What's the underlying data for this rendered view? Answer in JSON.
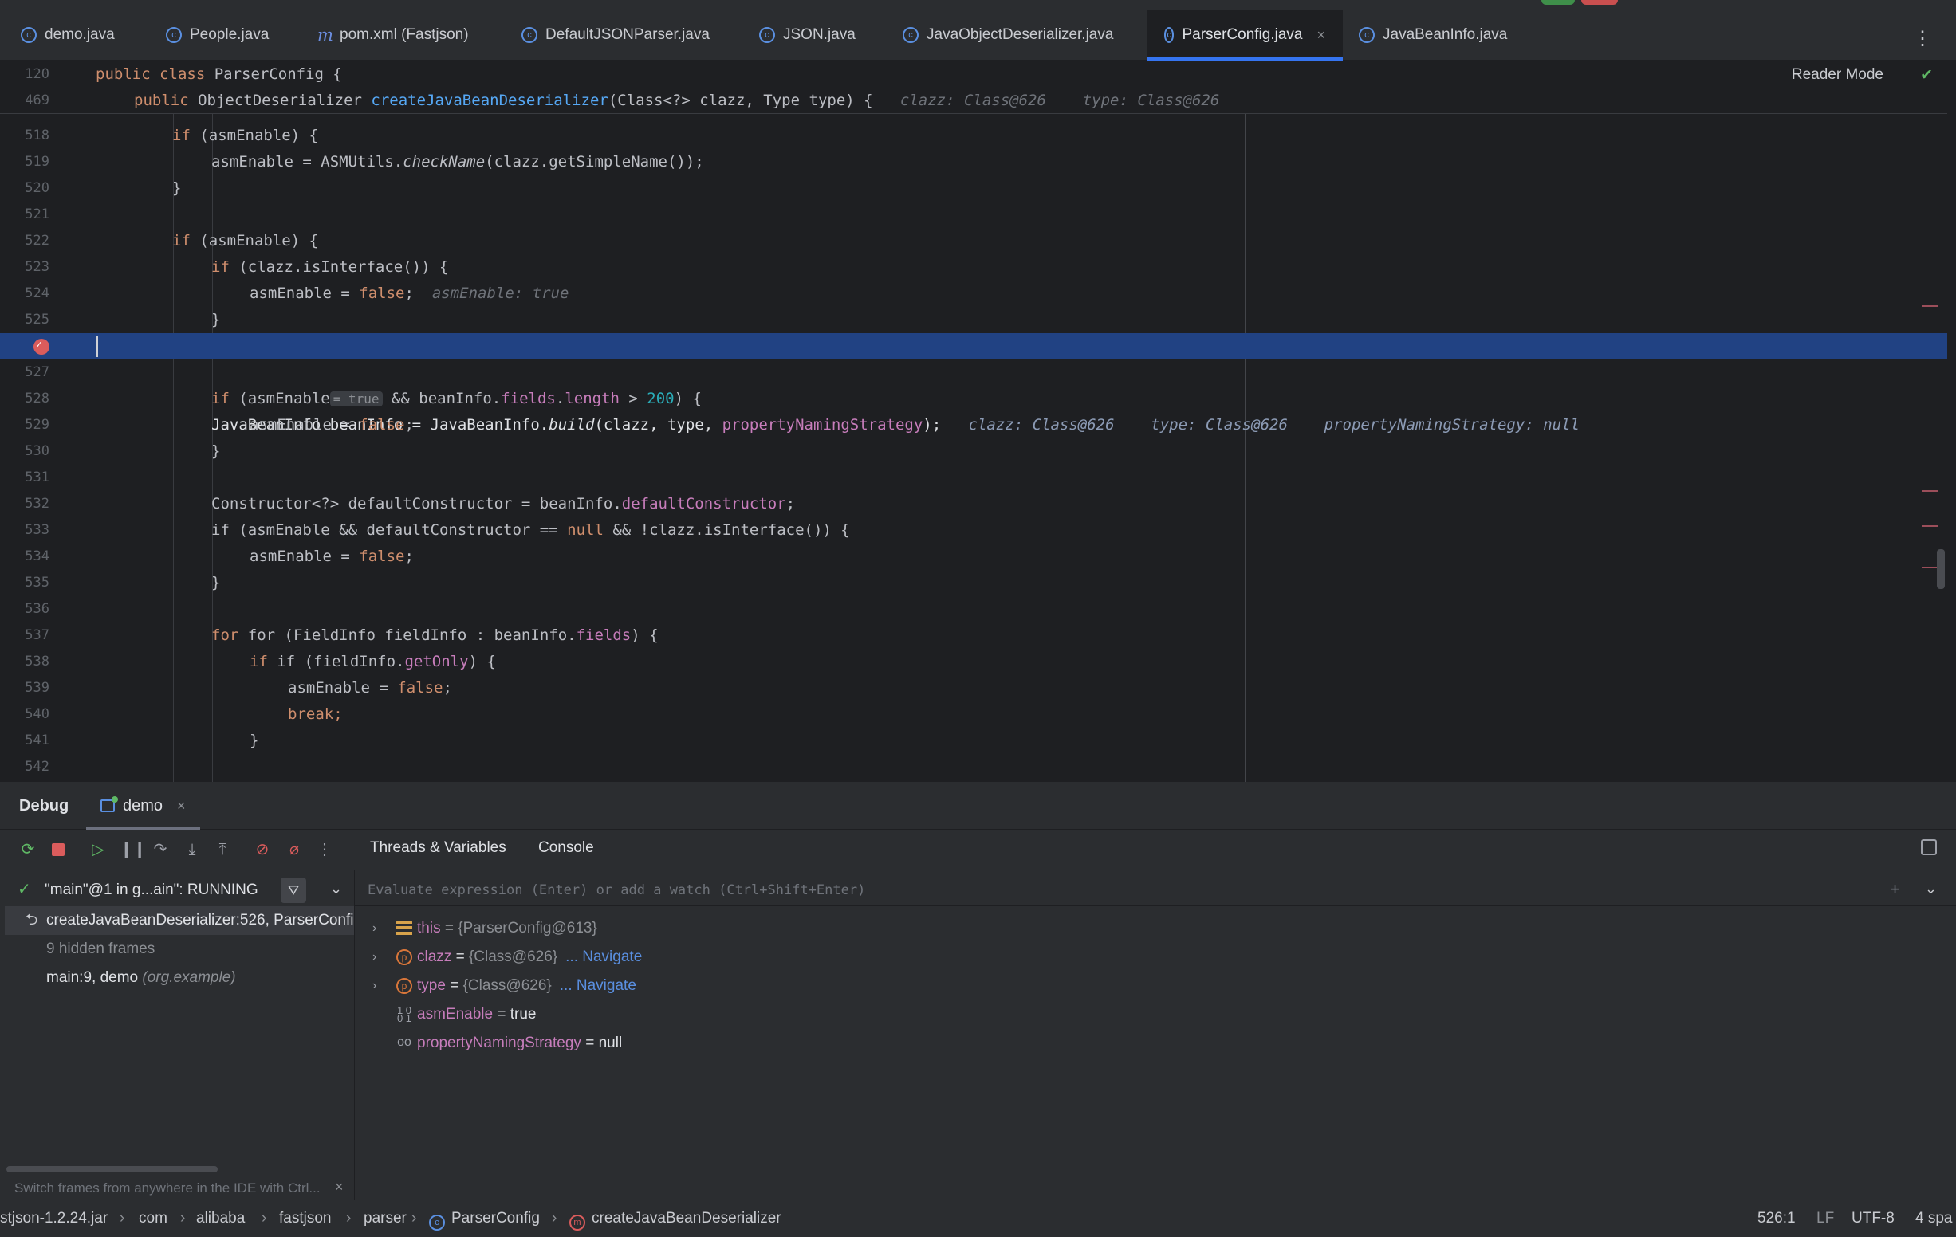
{
  "tabs": [
    {
      "label": "demo.java",
      "icon": "class-icon"
    },
    {
      "label": "People.java",
      "icon": "class-icon"
    },
    {
      "label": "pom.xml (Fastjson)",
      "icon": "maven-icon"
    },
    {
      "label": "DefaultJSONParser.java",
      "icon": "class-icon"
    },
    {
      "label": "JSON.java",
      "icon": "class-icon"
    },
    {
      "label": "JavaObjectDeserializer.java",
      "icon": "class-icon"
    },
    {
      "label": "ParserConfig.java",
      "icon": "class-icon",
      "active": true
    },
    {
      "label": "JavaBeanInfo.java",
      "icon": "class-icon"
    }
  ],
  "editor": {
    "reader_mode": "Reader Mode",
    "sticky": [
      {
        "ln": "120",
        "code": "public class ParserConfig {"
      },
      {
        "ln": "469",
        "code": "public ObjectDeserializer createJavaBeanDeserializer(Class<?> clazz, Type type) {",
        "hint1": "clazz: Class@626",
        "hint2": "type: Class@626"
      }
    ],
    "lines": [
      {
        "ln": "518",
        "code": "if (asmEnable) {"
      },
      {
        "ln": "519",
        "code_a": "asmEnable = ASMUtils.",
        "code_b": "checkName",
        "code_c": "(clazz.getSimpleName());"
      },
      {
        "ln": "520",
        "code": "}"
      },
      {
        "ln": "521",
        "code": ""
      },
      {
        "ln": "522",
        "code": "if (asmEnable) {"
      },
      {
        "ln": "523",
        "code": "if (clazz.isInterface()) {"
      },
      {
        "ln": "524",
        "code": "asmEnable = false;",
        "hint": "asmEnable: true"
      },
      {
        "ln": "525",
        "code": "}"
      },
      {
        "ln": "526",
        "code_a": "JavaBeanInfo beanInfo = JavaBeanInfo.",
        "code_b": "build",
        "code_c": "(clazz, type, ",
        "code_d": "propertyNamingStrategy",
        "code_e": ");",
        "hint1": "clazz: Class@626",
        "hint2": "type: Class@626",
        "hint3": "propertyNamingStrategy: null"
      },
      {
        "ln": "527",
        "code": ""
      },
      {
        "ln": "528",
        "code": "if (asmEnable",
        "inlay": "= true",
        "code_b": " && beanInfo.",
        "code_c": "fields",
        "code_d": ".",
        "code_e": "length",
        "code_f": " > ",
        "code_g": "200",
        "code_h": ") {"
      },
      {
        "ln": "529",
        "code": "asmEnable = false;"
      },
      {
        "ln": "530",
        "code": "}"
      },
      {
        "ln": "531",
        "code": ""
      },
      {
        "ln": "532",
        "code_a": "Constructor<?> defaultConstructor = beanInfo.",
        "code_b": "defaultConstructor",
        "code_c": ";"
      },
      {
        "ln": "533",
        "code_a": "if (asmEnable && defaultConstructor == ",
        "code_b": "null",
        "code_c": " && !clazz.isInterface()) {"
      },
      {
        "ln": "534",
        "code": "asmEnable = false;"
      },
      {
        "ln": "535",
        "code": "}"
      },
      {
        "ln": "536",
        "code": ""
      },
      {
        "ln": "537",
        "code_a": "for (FieldInfo fieldInfo : beanInfo.",
        "code_b": "fields",
        "code_c": ") {"
      },
      {
        "ln": "538",
        "code_a": "if (fieldInfo.",
        "code_b": "getOnly",
        "code_c": ") {"
      },
      {
        "ln": "539",
        "code": "asmEnable = false;"
      },
      {
        "ln": "540",
        "code": "break;"
      },
      {
        "ln": "541",
        "code": "}"
      },
      {
        "ln": "542",
        "code": ""
      }
    ]
  },
  "debug": {
    "title": "Debug",
    "session_tab": "demo",
    "panel_tabs": [
      "Threads & Variables",
      "Console"
    ],
    "thread": "\"main\"@1 in g...ain\": RUNNING",
    "frames": [
      {
        "label": "createJavaBeanDeserializer:526, ParserConfig",
        "selected": true
      },
      {
        "label": "9 hidden frames"
      },
      {
        "label": "main:9, demo",
        "pkg": "(org.example)"
      }
    ],
    "switch_tip": "Switch frames from anywhere in the IDE with Ctrl...",
    "eval_placeholder": "Evaluate expression (Enter) or add a watch (Ctrl+Shift+Enter)",
    "variables": [
      {
        "name": "this",
        "value": "{ParserConfig@613}",
        "icon": "object-icon",
        "expandable": true
      },
      {
        "name": "clazz",
        "value": "{Class@626}",
        "navigate": "... Navigate",
        "icon": "parameter-icon",
        "expandable": true
      },
      {
        "name": "type",
        "value": "{Class@626}",
        "navigate": "... Navigate",
        "icon": "parameter-icon",
        "expandable": true
      },
      {
        "name": "asmEnable",
        "value": "true",
        "icon": "local-var-icon"
      },
      {
        "name": "propertyNamingStrategy",
        "value": "null",
        "icon": "watch-icon"
      }
    ]
  },
  "statusbar": {
    "crumbs": [
      "stjson-1.2.24.jar",
      "com",
      "alibaba",
      "fastjson",
      "parser",
      "ParserConfig",
      "createJavaBeanDeserializer"
    ],
    "position": "526:1",
    "line_sep": "LF",
    "encoding": "UTF-8",
    "indent": "4 spa"
  },
  "colors": {
    "accent": "#3574f0",
    "keyword": "#cf8e6d",
    "function": "#56a8f5",
    "field": "#c77dbb",
    "selection": "#214283"
  }
}
